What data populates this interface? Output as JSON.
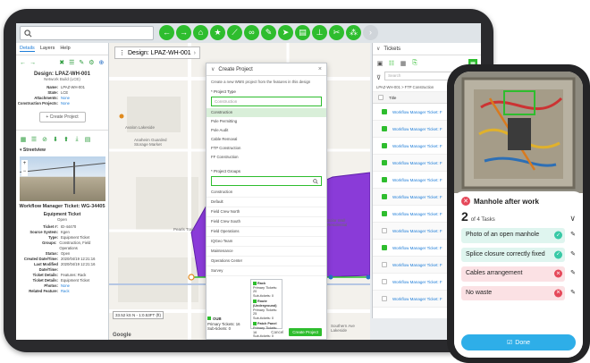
{
  "search": {
    "placeholder": ""
  },
  "toolbar": {
    "tools": [
      "back-arrow-icon",
      "forward-arrow-icon",
      "home-icon",
      "star-icon",
      "ruler-icon",
      "link-icon",
      "pencil-icon",
      "navigate-icon",
      "print-icon",
      "split-icon",
      "cut-icon",
      "network-icon",
      "more-icon"
    ]
  },
  "left_panel": {
    "tabs": [
      "Details",
      "Layers",
      "Help"
    ],
    "design_title": "Design: LPAZ-WH-001",
    "design_subtitle": "Network Build (LCE)",
    "fields": [
      {
        "k": "Name:",
        "v": "LPAZ-WH-001"
      },
      {
        "k": "State:",
        "v": "LCE"
      },
      {
        "k": "Attachments:",
        "v": "None",
        "link": true
      },
      {
        "k": "Construction Projects:",
        "v": "None",
        "link": true
      }
    ],
    "create_project_btn": "Create Project",
    "streetview_label": "Streetview",
    "ticket_title": "Workflow Manager Ticket: WG-34405",
    "ticket_sub_title": "Equipment Ticket",
    "ticket_sub_status": "Open",
    "ticket_fields": [
      {
        "k": "Ticket #:",
        "v": "ID-44470"
      },
      {
        "k": "Source System:",
        "v": "Kgen"
      },
      {
        "k": "Type:",
        "v": "Equipment Ticket"
      },
      {
        "k": "Groups:",
        "v": "Construction, Field Operations"
      },
      {
        "k": "Status:",
        "v": "Open"
      },
      {
        "k": "Created Date/Time:",
        "v": "2020/04/19 12:21:16"
      },
      {
        "k": "Last Modified Date/Time:",
        "v": "2020/04/19 12:21:16"
      },
      {
        "k": "Ticket Details:",
        "v": "Features: Rack"
      },
      {
        "k": "Ticket Details:",
        "v": "Equipment Ticket"
      },
      {
        "k": "Photos:",
        "v": "None",
        "link": true
      },
      {
        "k": "Related Feature:",
        "v": "Rack",
        "link": true
      }
    ]
  },
  "map": {
    "design_tab": "Design: LPAZ-WH-001",
    "labels": [
      "Avalon Lakeside",
      "Anaheim Guarded Storage Market",
      "Pearls Train",
      "Solar Wall Residential",
      "Southern Ave Lakeside"
    ],
    "scale": "33.52 kS N - 1:0.53FT (ft)",
    "google": "Google"
  },
  "modal": {
    "title": "Create Project",
    "description": "Create a new WMS project from the features in this design",
    "project_type_label": "* Project Type",
    "project_type_placeholder": "Construction",
    "project_types": [
      "Construction",
      "Pole Permitting",
      "Pole Audit",
      "Cable Removal",
      "FTP Construction",
      "FF Construction"
    ],
    "project_groups_label": "* Project Groups",
    "groups": [
      "Construction",
      "Default",
      "Field Crew North",
      "Field Crew South",
      "Field Operations",
      "IQGeo Team",
      "Maintenance",
      "Operations Center",
      "Survey"
    ],
    "cancel": "Cancel",
    "create": "Create Project"
  },
  "callout": {
    "items": [
      {
        "title": "Rack",
        "lines": [
          "Primary Tickets: 20",
          "Sub-tickets: 0"
        ]
      },
      {
        "title": "Route (Underground)",
        "lines": [
          "Primary Tickets: 25",
          "Sub-tickets: 0"
        ]
      },
      {
        "title": "Patch Panel",
        "lines": [
          "Primary Tickets: 16",
          "Sub-tickets: 0"
        ]
      }
    ]
  },
  "sub_info": {
    "header": "OUB",
    "lines": [
      "Primary Tickets: 16",
      "Sub-tickets: 0"
    ]
  },
  "tickets": {
    "title": "Tickets",
    "search_placeholder": "Search",
    "path": "LPAZ-WH-001 > FTP Construction",
    "col_title": "Title",
    "rows": [
      {
        "label": "Workflow Manager Ticket: F",
        "checked": true
      },
      {
        "label": "Workflow Manager Ticket: F",
        "checked": true
      },
      {
        "label": "Workflow Manager Ticket: F",
        "checked": true
      },
      {
        "label": "Workflow Manager Ticket: F",
        "checked": true
      },
      {
        "label": "Workflow Manager Ticket: F",
        "checked": true
      },
      {
        "label": "Workflow Manager Ticket: F",
        "checked": true
      },
      {
        "label": "Workflow Manager Ticket: F",
        "checked": true
      },
      {
        "label": "Workflow Manager Ticket: F",
        "checked": false
      },
      {
        "label": "Workflow Manager Ticket: F",
        "checked": true
      },
      {
        "label": "Workflow Manager Ticket: F",
        "checked": false
      },
      {
        "label": "Workflow Manager Ticket: F",
        "checked": false
      },
      {
        "label": "Workflow Manager Ticket: F",
        "checked": false
      }
    ]
  },
  "phone": {
    "sheet_title": "Manhole after work",
    "done_count": "2",
    "total_label": "of 4 Tasks",
    "tasks": [
      {
        "label": "Photo of an open manhole",
        "status": "ok"
      },
      {
        "label": "Splice closure correctly fixed",
        "status": "ok"
      },
      {
        "label": "Cables arrangement",
        "status": "bad"
      },
      {
        "label": "No waste",
        "status": "bad"
      }
    ],
    "done_button": "Done"
  },
  "colors": {
    "accent_green": "#2ebd2e",
    "polygon_purple": "#8a3bd8",
    "link_blue": "#1e7dd8",
    "done_blue": "#2eaee8",
    "error_red": "#e54859",
    "ok_teal": "#38c9a6"
  }
}
